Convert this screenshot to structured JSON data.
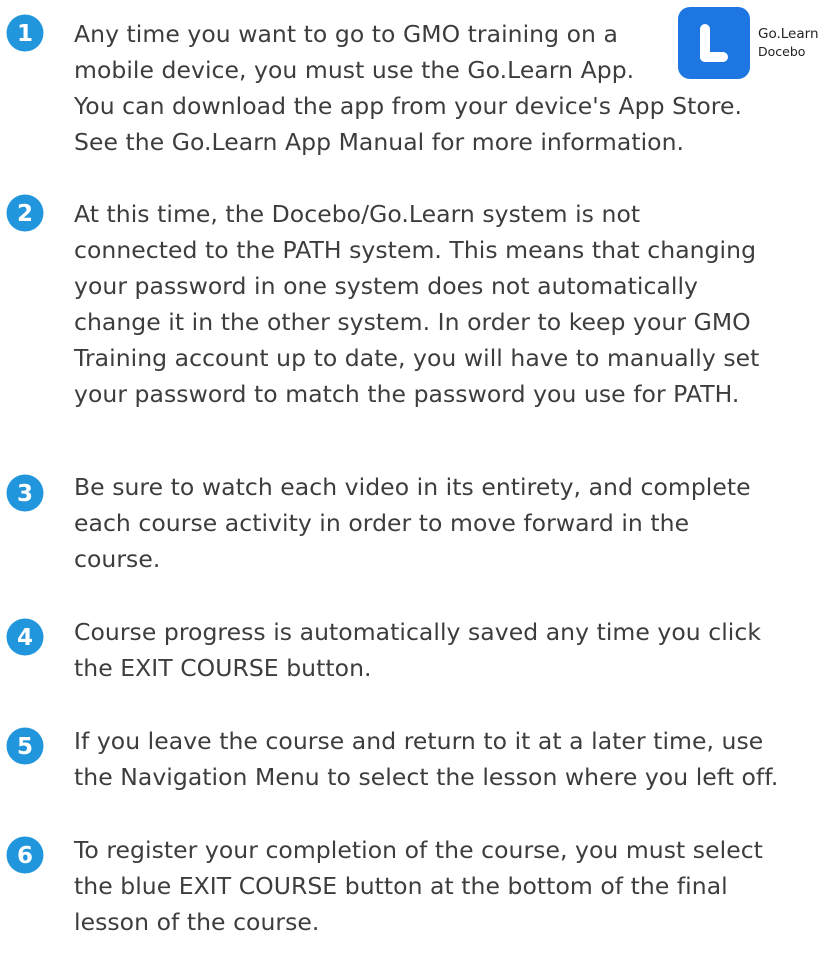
{
  "accent_color": "#2196dd",
  "app_badge": {
    "icon": "go-learn-app-icon",
    "name": "Go.Learn",
    "developer": "Docebo"
  },
  "items": [
    {
      "number": "1",
      "lines": [
        "Any time you want to go to GMO training on a",
        "mobile device, you must use the Go.Learn App.",
        "You can download the app from your device's App Store.",
        "See the Go.Learn App Manual for more information."
      ]
    },
    {
      "number": "2",
      "lines": [
        "At this time, the Docebo/Go.Learn system is not",
        "connected to the PATH system. This means that changing",
        "your password in one system does not automatically",
        "change it in the other system. In order to keep your GMO",
        "Training account up to date, you will have to manually set",
        "your password to match the password you use for PATH."
      ]
    },
    {
      "number": "3",
      "lines": [
        "Be sure to watch each video in its entirety, and complete",
        "each course activity in order to move forward in the",
        "course."
      ]
    },
    {
      "number": "4",
      "lines": [
        "Course progress is automatically saved any time you click",
        "the EXIT COURSE button."
      ]
    },
    {
      "number": "5",
      "lines": [
        "If you leave the course and return to it at a later time, use",
        "the Navigation Menu to select the lesson where you left off."
      ]
    },
    {
      "number": "6",
      "lines": [
        "To register your completion of the course, you must select",
        "the blue EXIT COURSE button at the bottom of the final",
        "lesson of the course."
      ]
    }
  ]
}
